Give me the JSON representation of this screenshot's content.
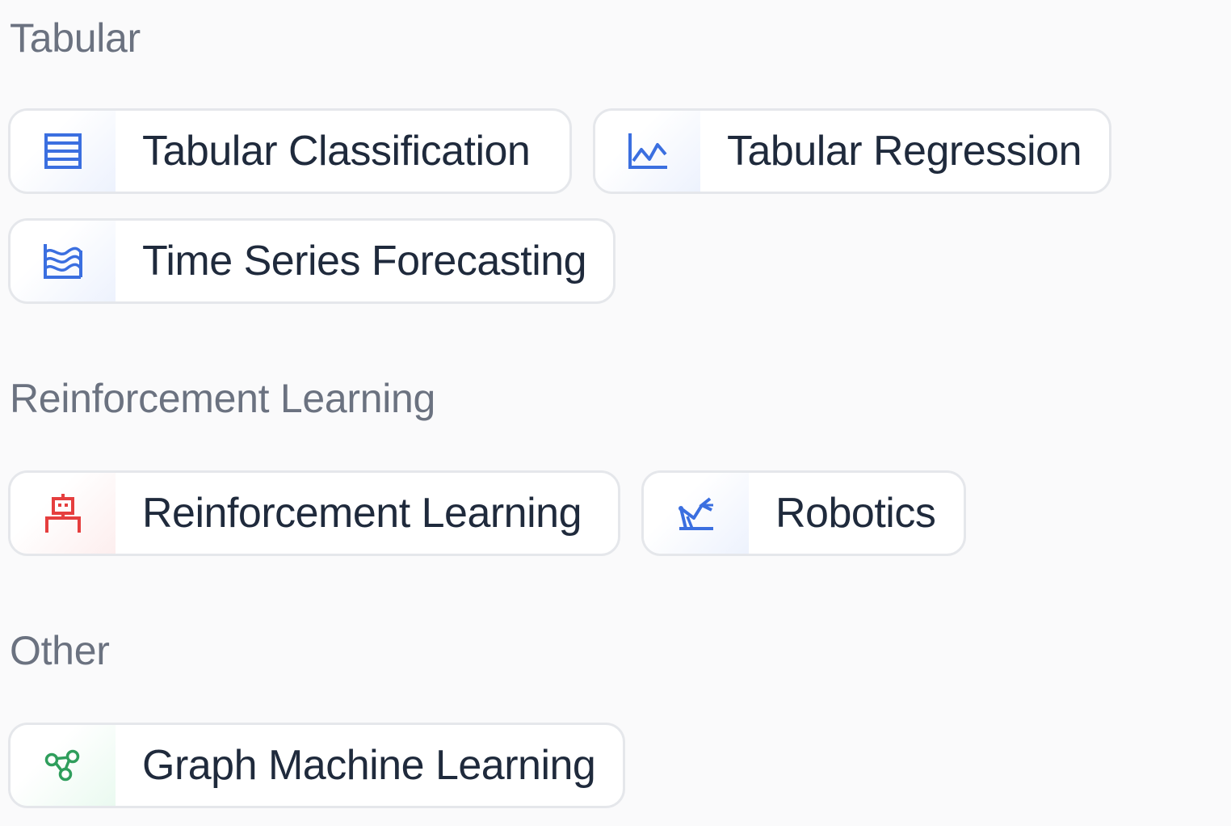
{
  "colors": {
    "section_title": "#6b7280",
    "chip_text": "#1f2a3c",
    "chip_border": "#e5e7eb",
    "icon_blue": "#3b6fe0",
    "icon_red": "#e53e3e",
    "icon_green": "#2f9e5c"
  },
  "sections": [
    {
      "title": "Tabular",
      "tasks": [
        {
          "label": "Tabular Classification",
          "icon": "table-icon",
          "color": "blue"
        },
        {
          "label": "Tabular Regression",
          "icon": "line-chart-icon",
          "color": "blue"
        },
        {
          "label": "Time Series Forecasting",
          "icon": "waves-icon",
          "color": "blue"
        }
      ]
    },
    {
      "title": "Reinforcement Learning",
      "tasks": [
        {
          "label": "Reinforcement Learning",
          "icon": "robot-icon",
          "color": "red"
        },
        {
          "label": "Robotics",
          "icon": "robotic-arm-icon",
          "color": "blue"
        }
      ]
    },
    {
      "title": "Other",
      "tasks": [
        {
          "label": "Graph Machine Learning",
          "icon": "graph-nodes-icon",
          "color": "green"
        }
      ]
    }
  ]
}
